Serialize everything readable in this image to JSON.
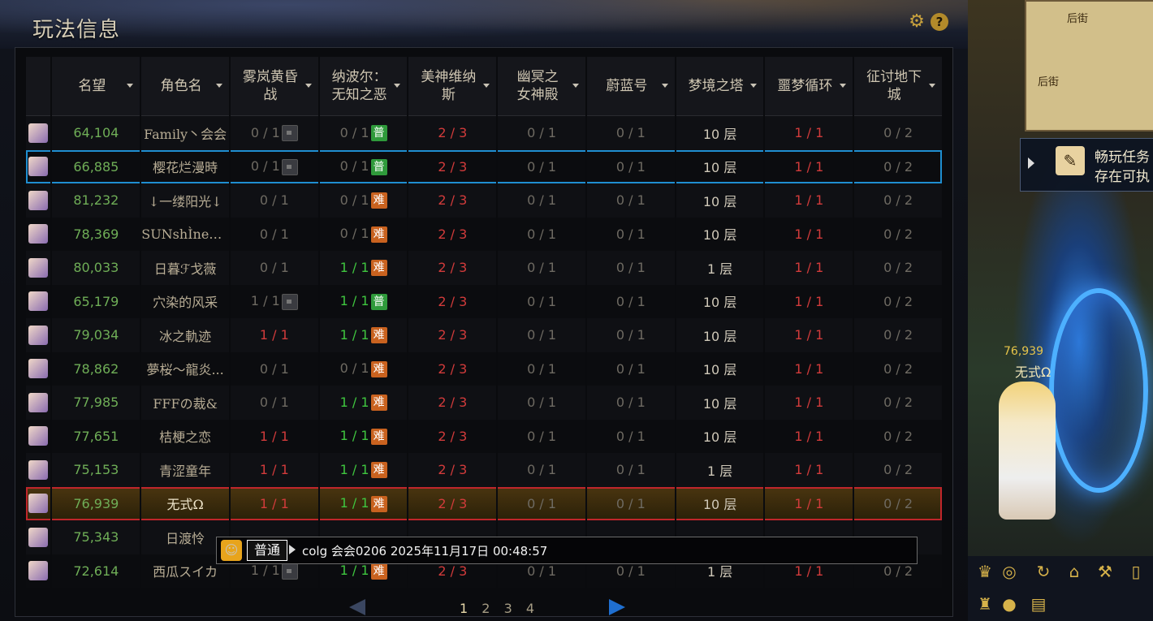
{
  "panel": {
    "title": "玩法信息",
    "gear_icon": "gear-icon",
    "help_label": "?"
  },
  "columns": [
    "",
    "名望",
    "角色名",
    "雾岚黄昏战",
    "纳波尔：无知之恶",
    "美神维纳斯",
    "幽冥之女神殿",
    "蔚蓝号",
    "梦境之塔",
    "噩梦循环",
    "征讨地下城"
  ],
  "column_lines": [
    [
      ""
    ],
    [
      "名望"
    ],
    [
      "角色名"
    ],
    [
      "雾岚黄昏",
      "战"
    ],
    [
      "纳波尔：",
      "无知之恶"
    ],
    [
      "美神维纳",
      "斯"
    ],
    [
      "幽冥之",
      "女神殿"
    ],
    [
      "蔚蓝号"
    ],
    [
      "梦境之塔"
    ],
    [
      "噩梦循环"
    ],
    [
      "征讨地下",
      "城"
    ]
  ],
  "badge_labels": {
    "normal": "普",
    "hard": "难"
  },
  "rows": [
    {
      "fame": "64,104",
      "name": "Family丶会会",
      "c1": "0 / 1",
      "c1_lock": true,
      "c2": "0 / 1",
      "c2_badge": "normal",
      "c3": "2 / 3",
      "c4": "0 / 1",
      "c5": "0 / 1",
      "c6": "10 层",
      "c7": "1 / 1",
      "c8": "0 / 2"
    },
    {
      "fame": "66,885",
      "name": "樱花烂漫時",
      "c1": "0 / 1",
      "c1_lock": true,
      "c2": "0 / 1",
      "c2_badge": "normal",
      "c3": "2 / 3",
      "c4": "0 / 1",
      "c5": "0 / 1",
      "c6": "10 层",
      "c7": "1 / 1",
      "c8": "0 / 2",
      "sel": "blue"
    },
    {
      "fame": "81,232",
      "name": "↓一缕阳光↓",
      "c1": "0 / 1",
      "c2": "0 / 1",
      "c2_badge": "hard",
      "c3": "2 / 3",
      "c4": "0 / 1",
      "c5": "0 / 1",
      "c6": "10 层",
      "c7": "1 / 1",
      "c8": "0 / 2"
    },
    {
      "fame": "78,369",
      "name": "SUNshÌneGir",
      "c1": "0 / 1",
      "c2": "0 / 1",
      "c2_badge": "hard",
      "c3": "2 / 3",
      "c4": "0 / 1",
      "c5": "0 / 1",
      "c6": "10 层",
      "c7": "1 / 1",
      "c8": "0 / 2"
    },
    {
      "fame": "80,033",
      "name": "日暮ℱ戈薇",
      "c1": "0 / 1",
      "c2": "1 / 1",
      "c2_badge": "hard",
      "c3": "2 / 3",
      "c4": "0 / 1",
      "c5": "0 / 1",
      "c6": "1 层",
      "c7": "1 / 1",
      "c8": "0 / 2"
    },
    {
      "fame": "65,179",
      "name": "穴染的风采",
      "c1": "1 / 1",
      "c1_lock": true,
      "c2": "1 / 1",
      "c2_badge": "normal",
      "c3": "2 / 3",
      "c4": "0 / 1",
      "c5": "0 / 1",
      "c6": "10 层",
      "c7": "1 / 1",
      "c8": "0 / 2"
    },
    {
      "fame": "79,034",
      "name": "冰之軌迹",
      "c1": "1 / 1",
      "c2": "1 / 1",
      "c2_badge": "hard",
      "c3": "2 / 3",
      "c4": "0 / 1",
      "c5": "0 / 1",
      "c6": "10 层",
      "c7": "1 / 1",
      "c8": "0 / 2"
    },
    {
      "fame": "78,862",
      "name": "夢桜～龍炎...",
      "c1": "0 / 1",
      "c2": "0 / 1",
      "c2_badge": "hard",
      "c3": "2 / 3",
      "c4": "0 / 1",
      "c5": "0 / 1",
      "c6": "10 层",
      "c7": "1 / 1",
      "c8": "0 / 2"
    },
    {
      "fame": "77,985",
      "name": "FFFの裁&",
      "c1": "0 / 1",
      "c2": "1 / 1",
      "c2_badge": "hard",
      "c3": "2 / 3",
      "c4": "0 / 1",
      "c5": "0 / 1",
      "c6": "10 层",
      "c7": "1 / 1",
      "c8": "0 / 2"
    },
    {
      "fame": "77,651",
      "name": "桔梗之恋",
      "c1": "1 / 1",
      "c2": "1 / 1",
      "c2_badge": "hard",
      "c3": "2 / 3",
      "c4": "0 / 1",
      "c5": "0 / 1",
      "c6": "10 层",
      "c7": "1 / 1",
      "c8": "0 / 2"
    },
    {
      "fame": "75,153",
      "name": "青涩童年",
      "c1": "1 / 1",
      "c2": "1 / 1",
      "c2_badge": "hard",
      "c3": "2 / 3",
      "c4": "0 / 1",
      "c5": "0 / 1",
      "c6": "1 层",
      "c7": "1 / 1",
      "c8": "0 / 2"
    },
    {
      "fame": "76,939",
      "name": "无式Ω",
      "c1": "1 / 1",
      "c2": "1 / 1",
      "c2_badge": "hard",
      "c3": "2 / 3",
      "c4": "0 / 1",
      "c5": "0 / 1",
      "c6": "10 层",
      "c7": "1 / 1",
      "c8": "0 / 2",
      "sel": "gold"
    },
    {
      "fame": "75,343",
      "name": "日渡怜",
      "c1": "",
      "c2": "",
      "c3": "",
      "c4": "",
      "c5": "",
      "c6": "",
      "c7": "",
      "c8": ""
    },
    {
      "fame": "72,614",
      "name": "西瓜スイカ",
      "c1": "1 / 1",
      "c1_lock": true,
      "c2": "1 / 1",
      "c2_badge": "hard",
      "c3": "2 / 3",
      "c4": "0 / 1",
      "c5": "0 / 1",
      "c6": "1 层",
      "c7": "1 / 1",
      "c8": "0 / 2"
    }
  ],
  "pager": {
    "pages": [
      "1",
      "2",
      "3",
      "4"
    ],
    "current": "1"
  },
  "chat": {
    "channel": "普通",
    "text": "colg 会会0206 2025年11月17日 00:48:57"
  },
  "scene": {
    "minimap_labels": [
      "后街",
      "后街"
    ],
    "quest_lines": [
      "畅玩任务",
      "存在可执"
    ],
    "char_fame": "76,939",
    "char_name": "无式Ω"
  },
  "colors": {
    "red": "#d23b3b",
    "green": "#3fc63f",
    "fame": "#6fae57",
    "select_blue": "#1f8ed0",
    "select_red": "#c0262b"
  }
}
